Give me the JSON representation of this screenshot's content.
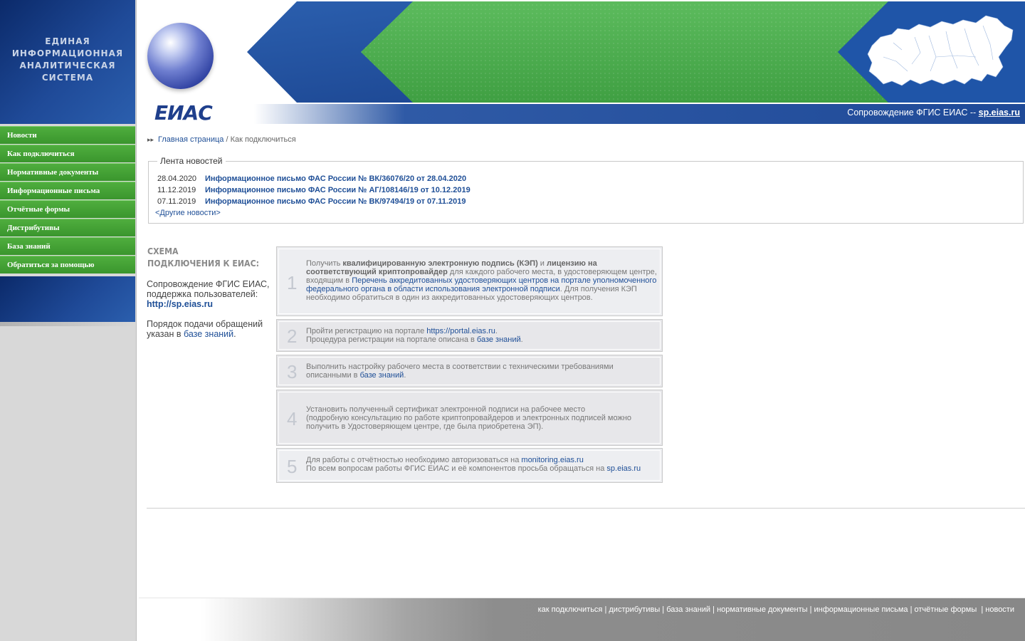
{
  "brand": {
    "logo_lines": [
      "ЕДИНАЯ",
      "ИНФОРМАЦИОННАЯ",
      "АНАЛИТИЧЕСКАЯ",
      "СИСТЕМА"
    ],
    "logo_text": "ЕИАС",
    "tagline_prefix": "Сопровождение ФГИС ЕИАС -- ",
    "tagline_link": "sp.eias.ru"
  },
  "nav": {
    "items": [
      {
        "label": "Новости"
      },
      {
        "label": "Как подключиться"
      },
      {
        "label": "Нормативные документы"
      },
      {
        "label": "Информационные письма"
      },
      {
        "label": "Отчётные формы"
      },
      {
        "label": "Дистрибутивы"
      },
      {
        "label": "База знаний"
      },
      {
        "label": "Обратиться за помощью"
      }
    ]
  },
  "breadcrumb": {
    "home": "Главная страница",
    "separator": " / ",
    "current": "Как подключиться"
  },
  "news": {
    "title": "Лента новостей",
    "items": [
      {
        "date": "28.04.2020",
        "title": "Информационное письмо ФАС России № ВК/36076/20 от 28.04.2020"
      },
      {
        "date": "11.12.2019",
        "title": "Информационное письмо ФАС России № АГ/108146/19 от 10.12.2019"
      },
      {
        "date": "07.11.2019",
        "title": "Информационное письмо ФАС России № ВК/97494/19 от 07.11.2019"
      }
    ],
    "more": "<Другие новости>"
  },
  "scheme": {
    "title_line1": "Схема",
    "title_line2": "подключения к ЕИАС:",
    "support_text": "Сопровождение ФГИС ЕИАС, поддержка пользователей:",
    "support_link": "http://sp.eias.ru",
    "order_text": "Порядок подачи обращений указан в ",
    "order_link": "базе знаний",
    "order_end": "."
  },
  "steps": [
    {
      "num": "1",
      "t1": "Получить ",
      "b1": "квалифицированную электронную подпись (КЭП)",
      "t2": " и ",
      "b2": "лицензию на соответствующий криптопровайдер",
      "t3": " для каждого рабочего места, в удостоверяющем центре, входящим в ",
      "link": "Перечень аккредитованных удостоверяющих центров на портале уполномоченного федерального органа в области использования электронной подписи",
      "t4": ". Для получения КЭП необходимо обратиться в один из аккредитованных удостоверяющих центров."
    },
    {
      "num": "2",
      "t1": "Пройти регистрацию на портале ",
      "link1": "https://portal.eias.ru",
      "t2": ".",
      "t3": "Процедура регистрации на портале описана в ",
      "link2": "базе знаний",
      "t4": "."
    },
    {
      "num": "3",
      "t1": "Выполнить настройку рабочего места в соответствии с техническими требованиями описанными в ",
      "link": "базе знаний",
      "t2": "."
    },
    {
      "num": "4",
      "l1": "Установить полученный сертификат электронной подписи на рабочее место",
      "l2": "(подробную консультацию по работе криптопровайдеров и электронных подписей можно получить в Удостоверяющем центре, где была приобретена ЭП)."
    },
    {
      "num": "5",
      "t1": "Для работы с отчётностью необходимо авторизоваться на ",
      "link1": "monitoring.eias.ru",
      "t2": "По всем вопросам работы ФГИС ЕИАС и её компонентов просьба обращаться на ",
      "link2": "sp.eias.ru"
    }
  ],
  "footer": {
    "links": [
      "как подключиться",
      "дистрибутивы",
      "база знаний",
      "нормативные документы",
      "информационные письма",
      "отчётные формы",
      "новости"
    ],
    "separator": " | "
  },
  "colors": {
    "brand_blue": "#1f4a98",
    "nav_green": "#3f9e33",
    "banner_green": "#4cae4f",
    "link_blue": "#1f4f97",
    "footer_gray": "#888888"
  },
  "icons": [
    "globe-icon",
    "russia-map-icon",
    "breadcrumb-arrow-icon"
  ]
}
